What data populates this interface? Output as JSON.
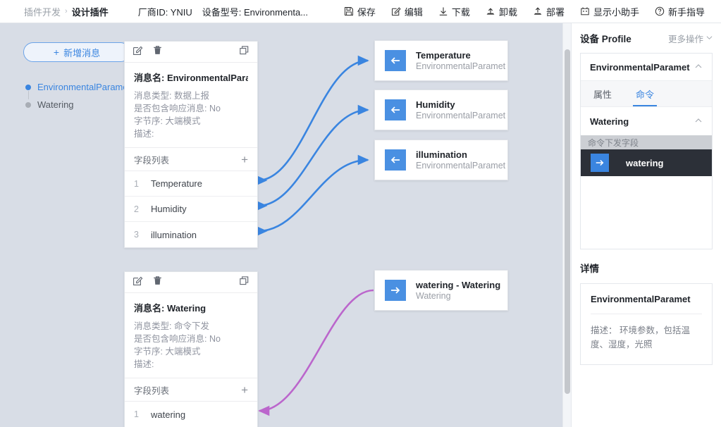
{
  "topbar": {
    "breadcrumb_parent": "插件开发",
    "breadcrumb_sep": "›",
    "breadcrumb_current": "设计插件",
    "vendor_id": "厂商ID: YNIU",
    "device_model": "设备型号: Environmenta...",
    "tools": [
      {
        "icon": "save-icon",
        "label": "保存"
      },
      {
        "icon": "edit-icon",
        "label": "编辑"
      },
      {
        "icon": "download-icon",
        "label": "下载"
      },
      {
        "icon": "uninstall-icon",
        "label": "卸载"
      },
      {
        "icon": "deploy-icon",
        "label": "部署"
      },
      {
        "icon": "assistant-icon",
        "label": "显示小助手"
      },
      {
        "icon": "help-icon",
        "label": "新手指导"
      }
    ]
  },
  "canvas": {
    "add_message_button": "新增消息",
    "tree": [
      {
        "label": "EnvironmentalParamet",
        "selected": true
      },
      {
        "label": "Watering",
        "selected": false
      }
    ],
    "messages": [
      {
        "title": "消息名: EnvironmentalPara...",
        "lines": [
          "消息类型: 数据上报",
          "是否包含响应消息: No",
          "字节序: 大端模式",
          "描述:"
        ],
        "field_list_label": "字段列表",
        "add_field": "+",
        "fields": [
          {
            "index": "1",
            "name": "Temperature"
          },
          {
            "index": "2",
            "name": "Humidity"
          },
          {
            "index": "3",
            "name": "illumination"
          }
        ]
      },
      {
        "title": "消息名: Watering",
        "lines": [
          "消息类型: 命令下发",
          "是否包含响应消息: No",
          "字节序: 大端模式",
          "描述:"
        ],
        "field_list_label": "字段列表",
        "add_field": "+",
        "fields": [
          {
            "index": "1",
            "name": "watering"
          }
        ]
      }
    ],
    "nodes": [
      {
        "icon": "arrow-left-icon",
        "title": "Temperature",
        "subtitle": "EnvironmentalParamet"
      },
      {
        "icon": "arrow-left-icon",
        "title": "Humidity",
        "subtitle": "EnvironmentalParamet"
      },
      {
        "icon": "arrow-left-icon",
        "title": "illumination",
        "subtitle": "EnvironmentalParamet"
      },
      {
        "icon": "arrow-right-icon",
        "title": "watering - Watering",
        "subtitle": "Watering"
      }
    ],
    "edge_color_data": "#3a85e0",
    "edge_color_command": "#bb66cc"
  },
  "right_panel": {
    "header": "设备 Profile",
    "more_actions": "更多操作",
    "service_name": "EnvironmentalParamet",
    "tabs": [
      {
        "label": "属性",
        "active": false
      },
      {
        "label": "命令",
        "active": true
      }
    ],
    "command_group": "Watering",
    "list_header": "命令下发字段",
    "selected_field": "watering",
    "selected_field_icon": "arrow-right-icon",
    "detail_title": "详情",
    "detail_name": "EnvironmentalParamet",
    "detail_desc": "描述： 环境参数，包括温度、湿度，光照"
  }
}
